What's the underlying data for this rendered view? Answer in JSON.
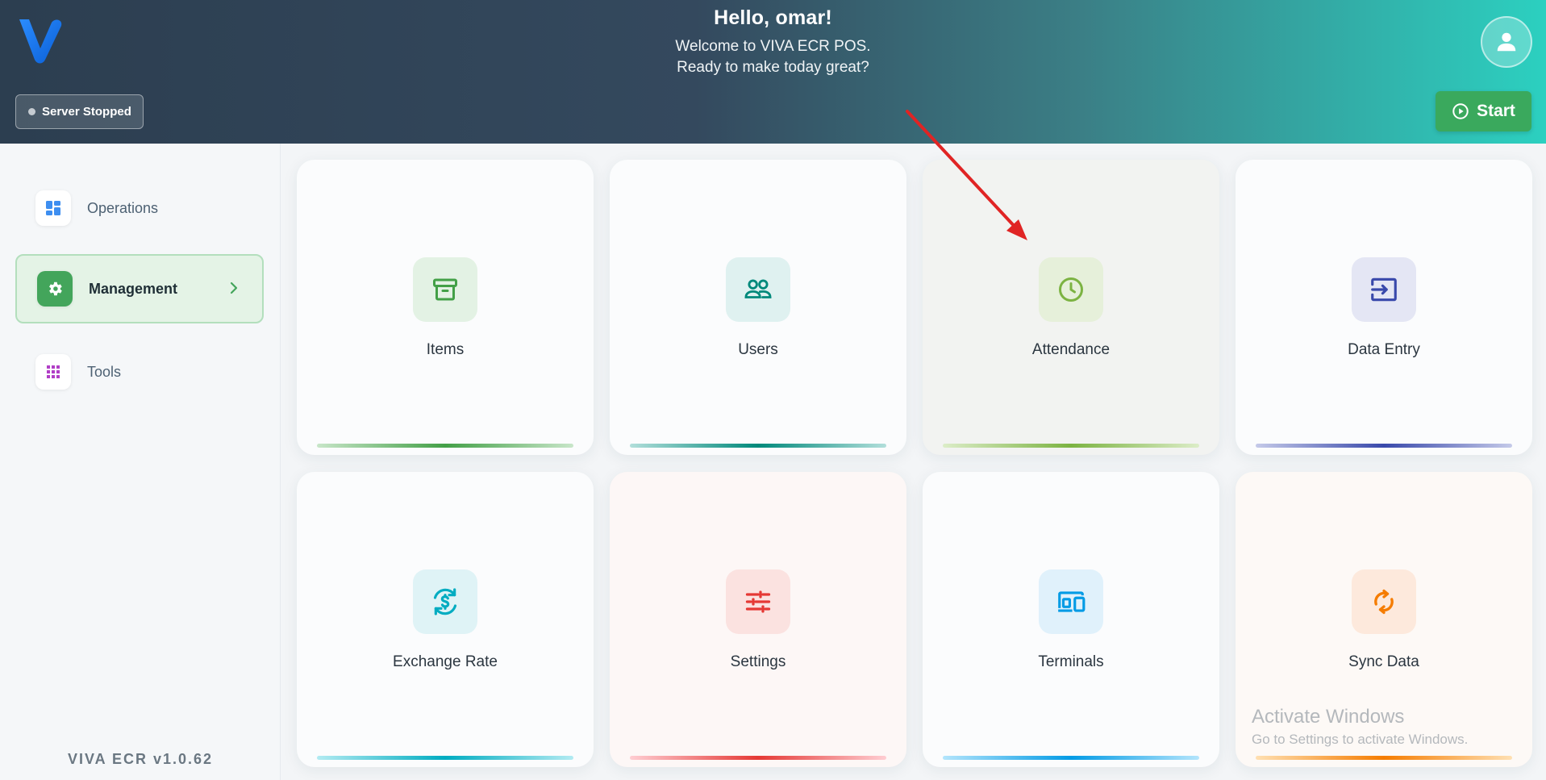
{
  "header": {
    "greeting": "Hello, omar!",
    "welcome": "Welcome to VIVA ECR POS.",
    "tagline": "Ready to make today great?",
    "server_status": "Server Stopped",
    "start_label": "Start"
  },
  "sidebar": {
    "items": [
      {
        "label": "Operations",
        "icon": "dashboard-icon"
      },
      {
        "label": "Management",
        "icon": "gear-icon",
        "active": true
      },
      {
        "label": "Tools",
        "icon": "apps-grid-icon"
      }
    ],
    "version": "VIVA ECR  v1.0.62"
  },
  "cards": [
    {
      "label": "Items",
      "icon": "archive-box-icon",
      "color": "#43a047"
    },
    {
      "label": "Users",
      "icon": "users-icon",
      "color": "#00897b"
    },
    {
      "label": "Attendance",
      "icon": "clock-icon",
      "color": "#7cb342"
    },
    {
      "label": "Data Entry",
      "icon": "login-box-icon",
      "color": "#3949ab"
    },
    {
      "label": "Exchange Rate",
      "icon": "currency-exchange-icon",
      "color": "#00acc1"
    },
    {
      "label": "Settings",
      "icon": "sliders-icon",
      "color": "#e53935"
    },
    {
      "label": "Terminals",
      "icon": "devices-icon",
      "color": "#039be5"
    },
    {
      "label": "Sync Data",
      "icon": "sync-icon",
      "color": "#f57c00"
    }
  ],
  "watermark": {
    "title": "Activate Windows",
    "subtitle": "Go to Settings to activate Windows."
  },
  "colors": {
    "accent_green": "#3aa95d",
    "annotation_arrow": "#e02424"
  }
}
